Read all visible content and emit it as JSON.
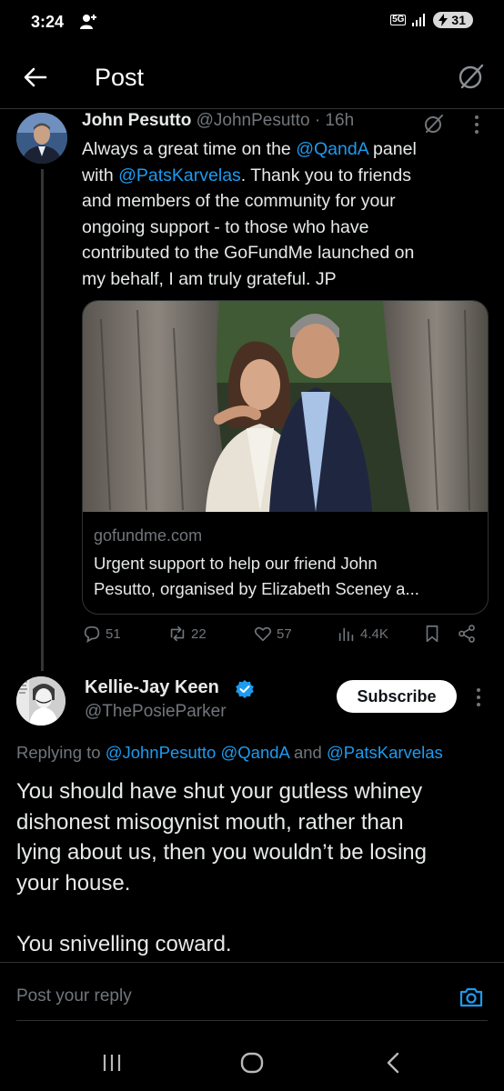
{
  "status_bar": {
    "time": "3:24",
    "network": "5G",
    "battery": "31"
  },
  "header": {
    "title": "Post"
  },
  "post": {
    "author_name": "John Pesutto",
    "author_handle": "@JohnPesutto",
    "time_ago": "· 16h",
    "text": {
      "l1_pre": "Always a great time on the ",
      "l1_link": "@QandA",
      "l1_post": " panel",
      "l2_pre": "with ",
      "l2_link": "@PatsKarvelas",
      "l2_post": ". Thank you to friends",
      "l3": "and members of the community for your",
      "l4": "ongoing support - to those who have",
      "l5": "contributed to the GoFundMe launched on",
      "l6": "my behalf, I am truly grateful. JP"
    },
    "card": {
      "domain": "gofundme.com",
      "title_line1": "Urgent support to help our friend John",
      "title_line2": "Pesutto, organised by Elizabeth Sceney a..."
    },
    "stats": {
      "replies": "51",
      "reposts": "22",
      "likes": "57",
      "views": "4.4K"
    }
  },
  "reply": {
    "author_name": "Kellie-Jay Keen",
    "author_handle": "@ThePosieParker",
    "subscribe_label": "Subscribe",
    "replying_prefix": "Replying to ",
    "replying_to_1": "@JohnPesutto",
    "replying_to_2": "@QandA",
    "replying_and": " and ",
    "replying_to_3": "@PatsKarvelas",
    "text": {
      "l1": "You should have shut your gutless whiney",
      "l2": "dishonest misogynist mouth,  rather than",
      "l3": "lying about us, then you wouldn’t be losing",
      "l4": "your house.",
      "l5": "You snivelling coward."
    }
  },
  "composer": {
    "placeholder": "Post your reply"
  },
  "colors": {
    "background": "#000000",
    "link": "#1d9bf0",
    "secondary_text": "#71767b",
    "primary_text": "#e7e9ea",
    "verified": "#1d9bf0"
  }
}
